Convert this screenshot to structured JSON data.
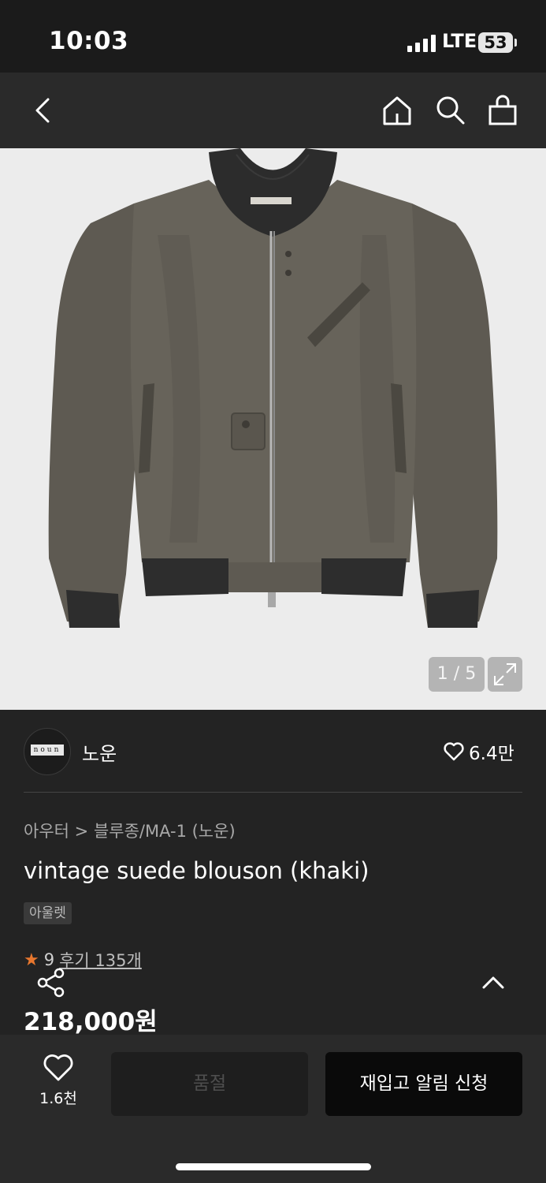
{
  "status": {
    "time": "10:03",
    "network": "LTE",
    "battery": "53"
  },
  "header": {
    "back_icon": "chevron-left-icon",
    "home_icon": "home-icon",
    "search_icon": "search-icon",
    "cart_icon": "shopping-bag-icon"
  },
  "gallery": {
    "counter": "1 / 5",
    "expand_icon": "expand-icon"
  },
  "brand": {
    "logo_text": "noun",
    "name": "노운",
    "likes": "6.4만"
  },
  "product": {
    "breadcrumb": [
      "아우터",
      "블루종/MA-1 (노운)"
    ],
    "title": "vintage suede blouson (khaki)",
    "tag": "아울렛",
    "rating_partial": "9",
    "reviews": "후기 135개",
    "price": "218,000원"
  },
  "bottom": {
    "wish_count": "1.6천",
    "soldout_label": "품절",
    "restock_label": "재입고 알림 신청"
  },
  "colors": {
    "background": "#232323",
    "image_bg": "#ececec",
    "accent": "#e8772e"
  }
}
